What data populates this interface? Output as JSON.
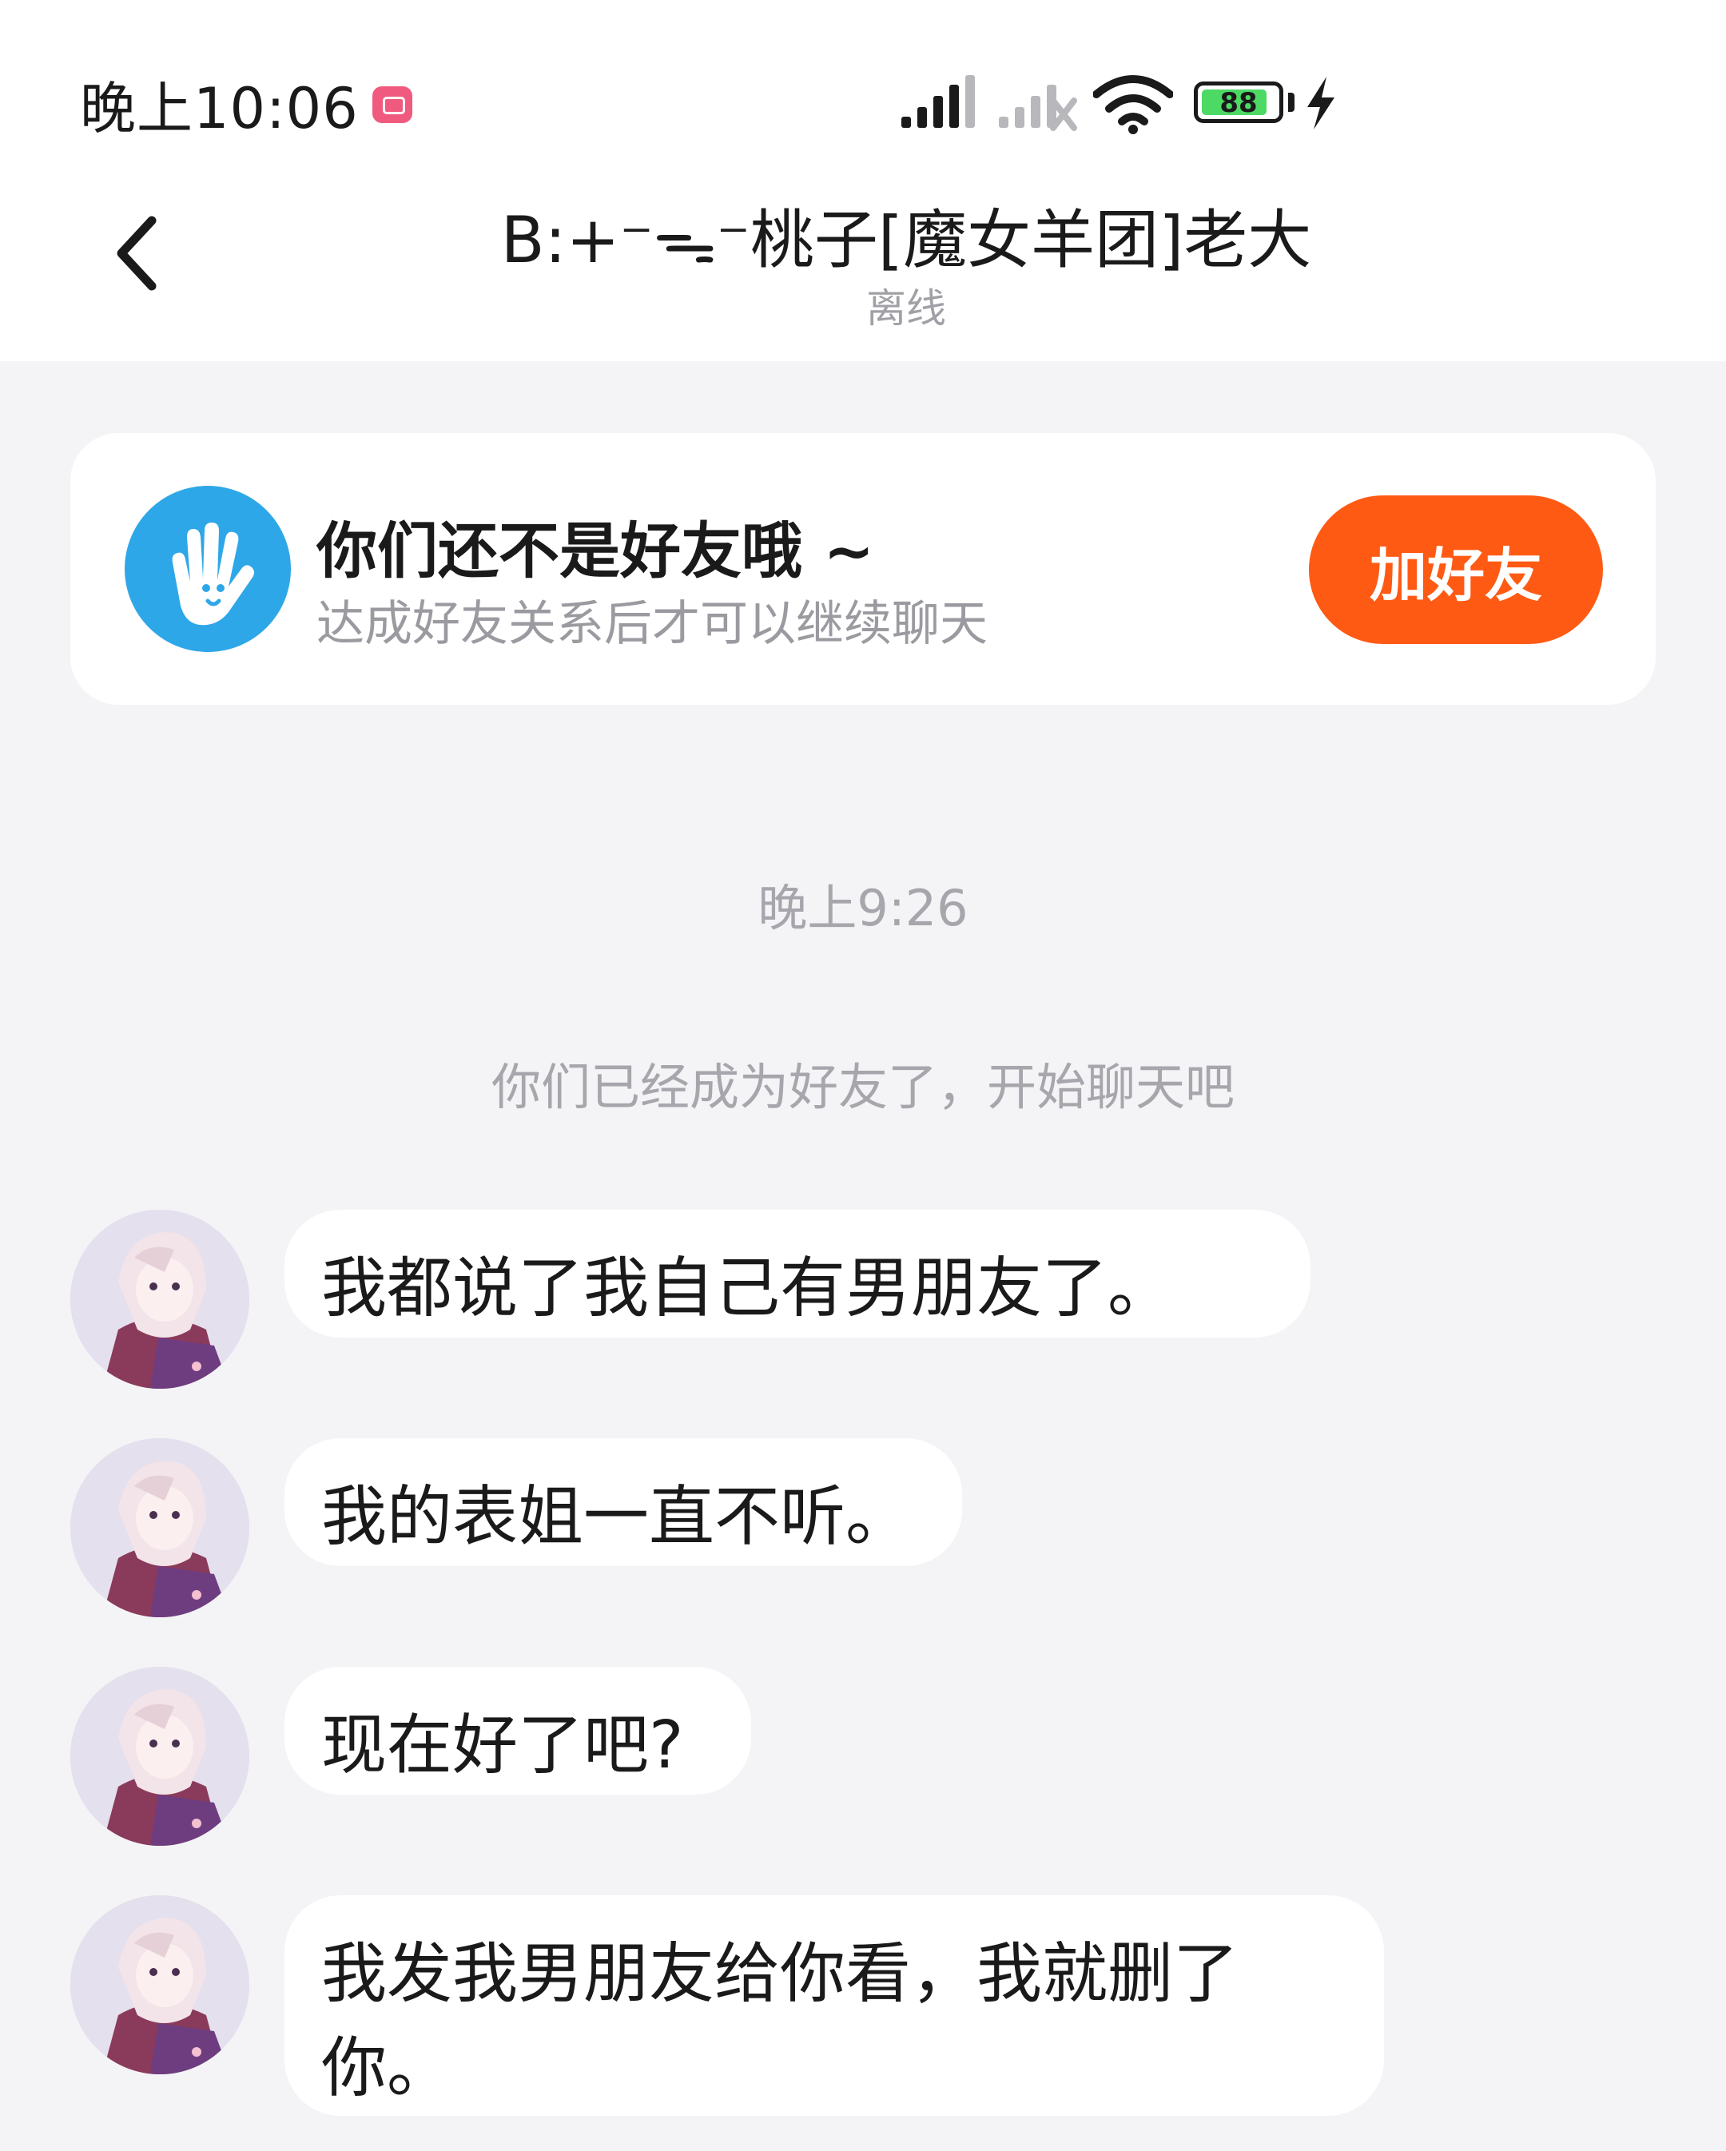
{
  "status_bar": {
    "time": "晚上10:06",
    "battery": "88",
    "battery_level": 0.88,
    "icons": [
      "notification-app-icon",
      "signal-icon",
      "signal-no-sim-icon",
      "wifi-icon",
      "battery-icon",
      "charging-icon"
    ]
  },
  "header": {
    "back_icon": "chevron-left-icon",
    "title": "B:+⁻ᯓ⁻桃子[魔女羊团]老大",
    "status": "离线"
  },
  "notice": {
    "icon": "hand-wave-icon",
    "title": "你们还不是好友哦 ~",
    "subtitle": "达成好友关系后才可以继续聊天",
    "button_label": "加好友"
  },
  "timestamp": "晚上9:26",
  "system_message": "你们已经成为好友了，开始聊天吧",
  "messages": [
    {
      "text": "我都说了我自己有男朋友了。"
    },
    {
      "text": "我的表姐一直不听。"
    },
    {
      "text": "现在好了吧?"
    },
    {
      "text": "我发我男朋友给你看，我就删了你。"
    }
  ],
  "colors": {
    "accent": "#ff5a14",
    "notice_icon": "#2ea7e8",
    "background": "#f4f4f6",
    "muted_text": "#a6a6ac"
  }
}
